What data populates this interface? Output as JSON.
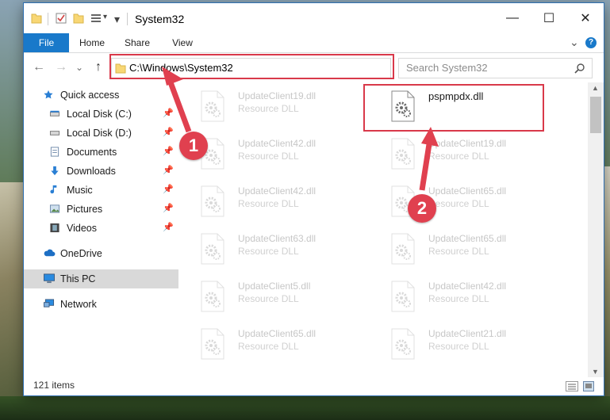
{
  "window": {
    "title": "System32",
    "controls": {
      "minimize": "—",
      "maximize": "☐",
      "close": "✕"
    }
  },
  "ribbon": {
    "tabs": [
      "File",
      "Home",
      "Share",
      "View"
    ],
    "help_glyph": "?",
    "expand_glyph": "⌄"
  },
  "navigation": {
    "back": "←",
    "forward": "→",
    "dropdown": "⌄",
    "up": "↑",
    "address": "C:\\Windows\\System32",
    "refresh": "↻",
    "search_placeholder": "Search System32"
  },
  "sidebar": {
    "items": [
      {
        "label": "Quick access",
        "icon": "star-icon",
        "pinned": false
      },
      {
        "label": "Local Disk (C:)",
        "icon": "drive-icon",
        "pinned": true
      },
      {
        "label": "Local Disk (D:)",
        "icon": "drive-icon",
        "pinned": true
      },
      {
        "label": "Documents",
        "icon": "documents-icon",
        "pinned": true
      },
      {
        "label": "Downloads",
        "icon": "download-icon",
        "pinned": true
      },
      {
        "label": "Music",
        "icon": "music-icon",
        "pinned": true
      },
      {
        "label": "Pictures",
        "icon": "pictures-icon",
        "pinned": true
      },
      {
        "label": "Videos",
        "icon": "videos-icon",
        "pinned": true
      },
      {
        "label": "OneDrive",
        "icon": "cloud-icon",
        "pinned": false
      },
      {
        "label": "This PC",
        "icon": "computer-icon",
        "pinned": false,
        "selected": true
      },
      {
        "label": "Network",
        "icon": "network-icon",
        "pinned": false
      }
    ]
  },
  "files": {
    "type_label": "Resource DLL",
    "left_column": [
      "UpdateClient19.dll",
      "UpdateClient42.dll",
      "UpdateClient42.dll",
      "UpdateClient63.dll",
      "UpdateClient5.dll",
      "UpdateClient65.dll"
    ],
    "right_column": [
      "pspmpdx.dll",
      "UpdateClient19.dll",
      "UpdateClient65.dll",
      "UpdateClient65.dll",
      "UpdateClient42.dll",
      "UpdateClient21.dll"
    ]
  },
  "status": {
    "item_count": "121 items"
  },
  "annotations": {
    "step1": "1",
    "step2": "2",
    "color": "#e0404f"
  }
}
